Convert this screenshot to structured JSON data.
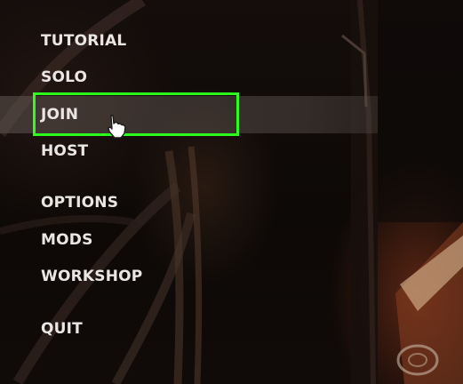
{
  "menu": {
    "items": [
      {
        "id": "tutorial",
        "label": "TUTORIAL"
      },
      {
        "id": "solo",
        "label": "SOLO"
      },
      {
        "id": "join",
        "label": "JOIN"
      },
      {
        "id": "host",
        "label": "HOST"
      },
      {
        "id": "options",
        "label": "OPTIONS"
      },
      {
        "id": "mods",
        "label": "MODS"
      },
      {
        "id": "workshop",
        "label": "WORKSHOP"
      },
      {
        "id": "quit",
        "label": "QUIT"
      }
    ],
    "selected": "JOIN"
  },
  "colors": {
    "highlight_outline": "#2cff1e",
    "menu_text": "#e9e6e3",
    "selected_row": "#5f5550"
  },
  "icons": {
    "cursor": "hand-pointer-icon"
  }
}
